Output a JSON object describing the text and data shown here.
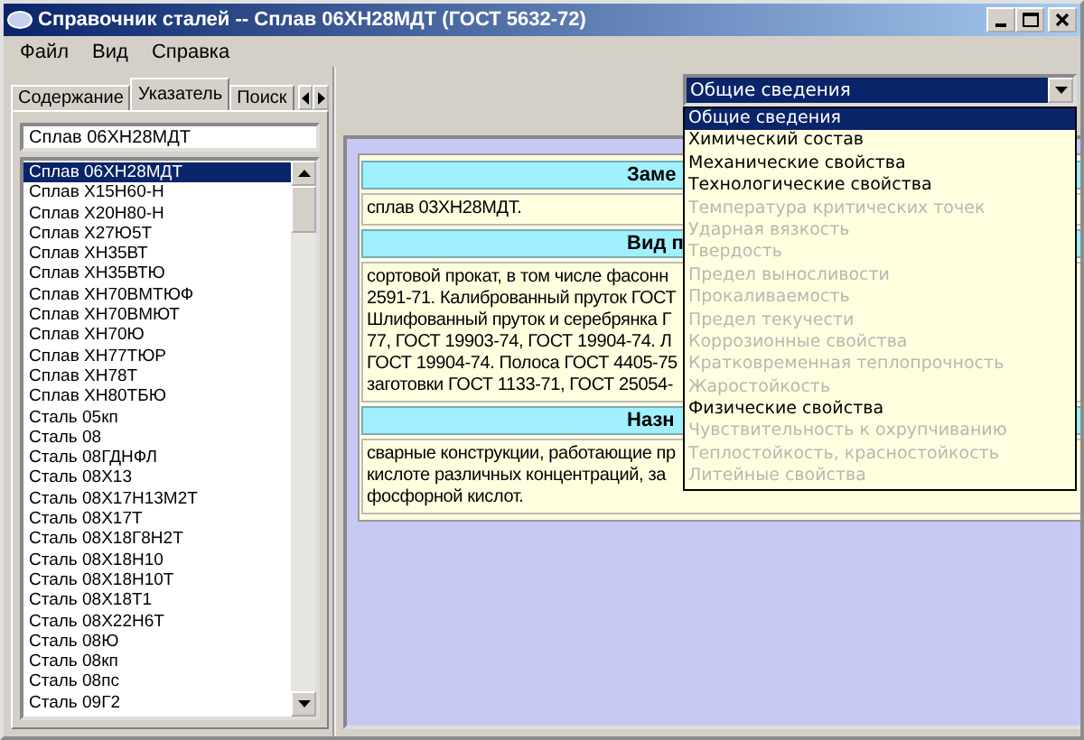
{
  "window": {
    "title": "Справочник сталей -- Сплав 06ХН28МДТ  (ГОСТ 5632-72)"
  },
  "menu": [
    "Файл",
    "Вид",
    "Справка"
  ],
  "tabs": [
    {
      "label": "Содержание",
      "selected": false
    },
    {
      "label": "Указатель",
      "selected": true
    },
    {
      "label": "Поиск",
      "selected": false
    }
  ],
  "search": {
    "value": "Сплав 06ХН28МДТ"
  },
  "index_list": [
    {
      "label": "Сплав 06ХН28МДТ",
      "selected": true
    },
    {
      "label": "Сплав Х15Н60-Н",
      "selected": false
    },
    {
      "label": "Сплав Х20Н80-Н",
      "selected": false
    },
    {
      "label": "Сплав Х27Ю5Т",
      "selected": false
    },
    {
      "label": "Сплав ХН35ВТ",
      "selected": false
    },
    {
      "label": "Сплав ХН35ВТЮ",
      "selected": false
    },
    {
      "label": "Сплав ХН70ВМТЮФ",
      "selected": false
    },
    {
      "label": "Сплав ХН70ВМЮТ",
      "selected": false
    },
    {
      "label": "Сплав ХН70Ю",
      "selected": false
    },
    {
      "label": "Сплав ХН77ТЮР",
      "selected": false
    },
    {
      "label": "Сплав ХН78Т",
      "selected": false
    },
    {
      "label": "Сплав ХН80ТБЮ",
      "selected": false
    },
    {
      "label": "Сталь 05кп",
      "selected": false
    },
    {
      "label": "Сталь 08",
      "selected": false
    },
    {
      "label": "Сталь 08ГДНФЛ",
      "selected": false
    },
    {
      "label": "Сталь 08Х13",
      "selected": false
    },
    {
      "label": "Сталь 08Х17Н13М2Т",
      "selected": false
    },
    {
      "label": "Сталь 08Х17Т",
      "selected": false
    },
    {
      "label": "Сталь 08Х18Г8Н2Т",
      "selected": false
    },
    {
      "label": "Сталь 08Х18Н10",
      "selected": false
    },
    {
      "label": "Сталь 08Х18Н10Т",
      "selected": false
    },
    {
      "label": "Сталь 08Х18Т1",
      "selected": false
    },
    {
      "label": "Сталь 08Х22Н6Т",
      "selected": false
    },
    {
      "label": "Сталь 08Ю",
      "selected": false
    },
    {
      "label": "Сталь 08кп",
      "selected": false
    },
    {
      "label": "Сталь 08пс",
      "selected": false
    },
    {
      "label": "Сталь 09Г2",
      "selected": false
    }
  ],
  "sections": [
    {
      "heading": "Заме",
      "lines": [
        "сплав 03ХН28МДТ."
      ]
    },
    {
      "heading": "Вид п",
      "lines": [
        "сортовой прокат, в том числе фасонн",
        "2591-71. Калиброванный пруток ГОСТ",
        "Шлифованный пруток и серебрянка Г",
        "77, ГОСТ 19903-74, ГОСТ 19904-74. Л",
        "ГОСТ 19904-74. Полоса ГОСТ 4405-75",
        "заготовки ГОСТ 1133-71, ГОСТ 25054-"
      ]
    },
    {
      "heading": "Назн",
      "lines": [
        "сварные конструкции, работающие пр",
        "кислоте различных концентраций, за",
        "фосфорной кислот."
      ]
    }
  ],
  "topic_dropdown": {
    "value": "Общие сведения",
    "options": [
      {
        "label": "Общие сведения",
        "selected": true,
        "disabled": false
      },
      {
        "label": "Химический состав",
        "selected": false,
        "disabled": false
      },
      {
        "label": "Механические свойства",
        "selected": false,
        "disabled": false
      },
      {
        "label": "Технологические свойства",
        "selected": false,
        "disabled": false
      },
      {
        "label": "Температура критических точек",
        "selected": false,
        "disabled": true
      },
      {
        "label": "Ударная вязкость",
        "selected": false,
        "disabled": true
      },
      {
        "label": "Твердость",
        "selected": false,
        "disabled": true
      },
      {
        "label": "Предел выносливости",
        "selected": false,
        "disabled": true
      },
      {
        "label": "Прокаливаемость",
        "selected": false,
        "disabled": true
      },
      {
        "label": "Предел текучести",
        "selected": false,
        "disabled": true
      },
      {
        "label": "Коррозионные свойства",
        "selected": false,
        "disabled": true
      },
      {
        "label": "Кратковременная теплопрочность",
        "selected": false,
        "disabled": true
      },
      {
        "label": "Жаростойкость",
        "selected": false,
        "disabled": true
      },
      {
        "label": "Физические свойства",
        "selected": false,
        "disabled": false
      },
      {
        "label": "Чувствительность к охрупчиванию",
        "selected": false,
        "disabled": true
      },
      {
        "label": "Теплостойкость, красностойкость",
        "selected": false,
        "disabled": true
      },
      {
        "label": "Литейные свойства",
        "selected": false,
        "disabled": true
      }
    ]
  }
}
